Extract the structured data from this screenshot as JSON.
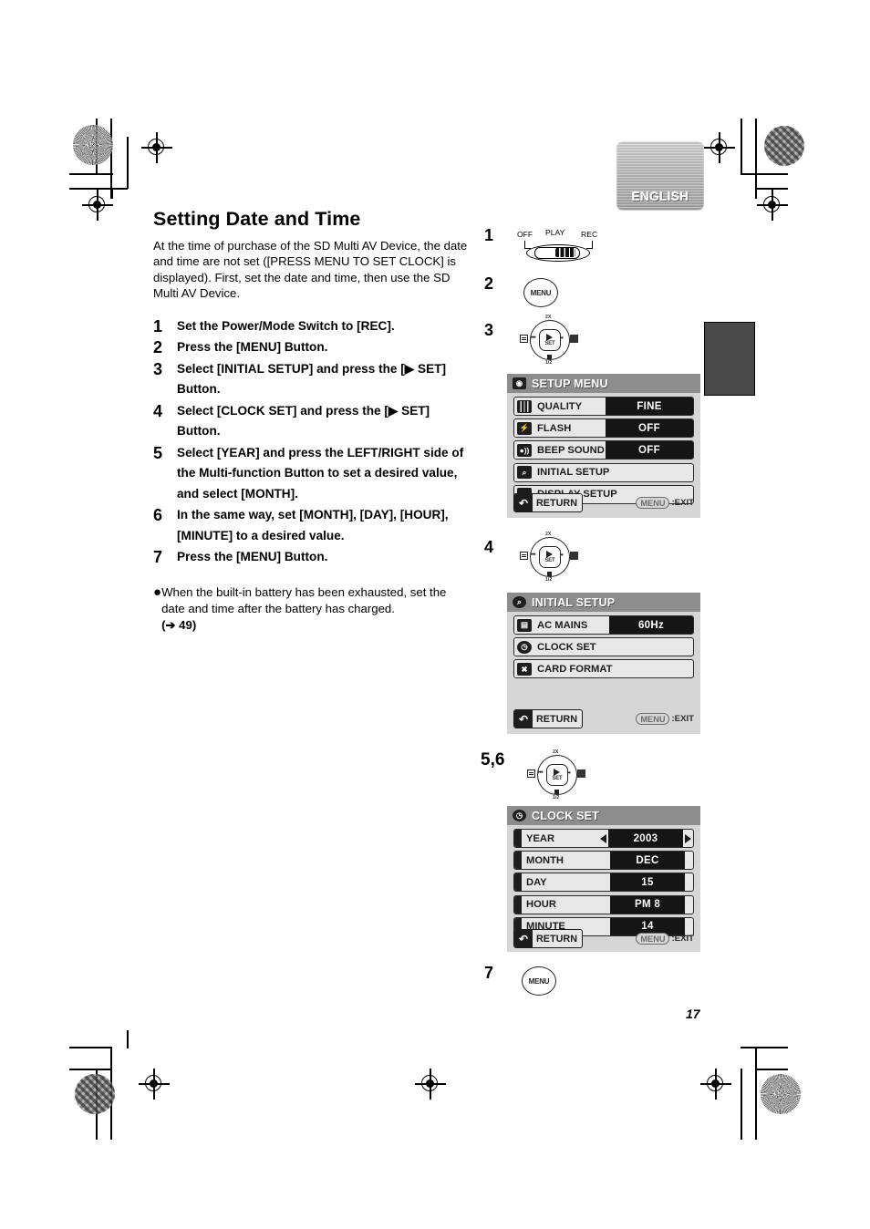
{
  "document": {
    "language_tab": "ENGLISH",
    "page_number": "17"
  },
  "article": {
    "title": "Setting Date and Time",
    "intro": "At the time of purchase of the SD Multi AV Device, the date and time are not set ([PRESS MENU TO SET CLOCK] is displayed). First, set the date and time, then use the SD Multi AV Device.",
    "steps": [
      {
        "num": "1",
        "text": "Set the Power/Mode Switch to [REC]."
      },
      {
        "num": "2",
        "text": "Press the [MENU] Button."
      },
      {
        "num": "3",
        "text": "Select [INITIAL SETUP] and press the [▶ SET] Button."
      },
      {
        "num": "4",
        "text": "Select [CLOCK SET] and press the [▶ SET] Button."
      },
      {
        "num": "5",
        "text": "Select [YEAR] and press the LEFT/RIGHT side of the Multi-function Button to set a desired value, and select [MONTH]."
      },
      {
        "num": "6",
        "text": "In the same way, set [MONTH], [DAY], [HOUR], [MINUTE] to a desired value."
      },
      {
        "num": "7",
        "text": "Press the [MENU] Button."
      }
    ],
    "note": {
      "bullet": "●",
      "text": "When the built-in battery has been exhausted, set the date and time after the battery has charged.",
      "reference": "(➔ 49)"
    }
  },
  "figures": {
    "step_labels": {
      "s1": "1",
      "s2": "2",
      "s3": "3",
      "s4": "4",
      "s56": "5,6",
      "s7": "7"
    },
    "power_switch": {
      "positions": [
        "OFF",
        "PLAY",
        "REC"
      ],
      "selected": "REC"
    },
    "menu_button_label": "MENU",
    "multi_function_button": {
      "center_label": "SET",
      "up_tag": "2X",
      "down_tag": "1/2",
      "left_tag": "◀◀",
      "right_tag": "▶▶",
      "pause_glyph": "❙❙",
      "stop_glyph": "■",
      "prev_glyph": "⏮",
      "next_glyph": "⏭",
      "play_glyph": "▶"
    }
  },
  "osd_setup_menu": {
    "title": "SETUP MENU",
    "title_icon": "camera-icon",
    "rows": [
      {
        "icon": "quality-grid-icon",
        "label": "QUALITY",
        "value": "FINE",
        "has_value": true
      },
      {
        "icon": "flash-icon",
        "label": "FLASH",
        "value": "OFF",
        "has_value": true
      },
      {
        "icon": "beep-sound-icon",
        "label": "BEEP SOUND",
        "value": "OFF",
        "has_value": true
      },
      {
        "icon": "initial-setup-icon",
        "label": "INITIAL SETUP",
        "value": "",
        "has_value": false
      },
      {
        "icon": "display-setup-icon",
        "label": "DISPLAY SETUP",
        "value": "",
        "has_value": false
      }
    ],
    "return_label": "RETURN",
    "exit_key": "MENU",
    "exit_text": ":EXIT"
  },
  "osd_initial_setup": {
    "title": "INITIAL SETUP",
    "title_icon": "tools-icon",
    "rows": [
      {
        "icon": "ac-mains-icon",
        "label": "AC MAINS",
        "value": "60Hz",
        "has_value": true
      },
      {
        "icon": "clock-icon",
        "label": "CLOCK SET",
        "value": "",
        "has_value": false
      },
      {
        "icon": "card-format-icon",
        "label": "CARD FORMAT",
        "value": "",
        "has_value": false
      }
    ],
    "return_label": "RETURN",
    "exit_key": "MENU",
    "exit_text": ":EXIT"
  },
  "osd_clock_set": {
    "title": "CLOCK SET",
    "title_icon": "clock-icon",
    "rows": [
      {
        "label": "YEAR",
        "value": "2003",
        "selected": true
      },
      {
        "label": "MONTH",
        "value": "DEC",
        "selected": false
      },
      {
        "label": "DAY",
        "value": "15",
        "selected": false
      },
      {
        "label": "HOUR",
        "value": "PM 8",
        "selected": false
      },
      {
        "label": "MINUTE",
        "value": "14",
        "selected": false
      }
    ],
    "return_label": "RETURN",
    "exit_key": "MENU",
    "exit_text": ":EXIT",
    "arrow_left": "◀",
    "arrow_right": "▶"
  }
}
